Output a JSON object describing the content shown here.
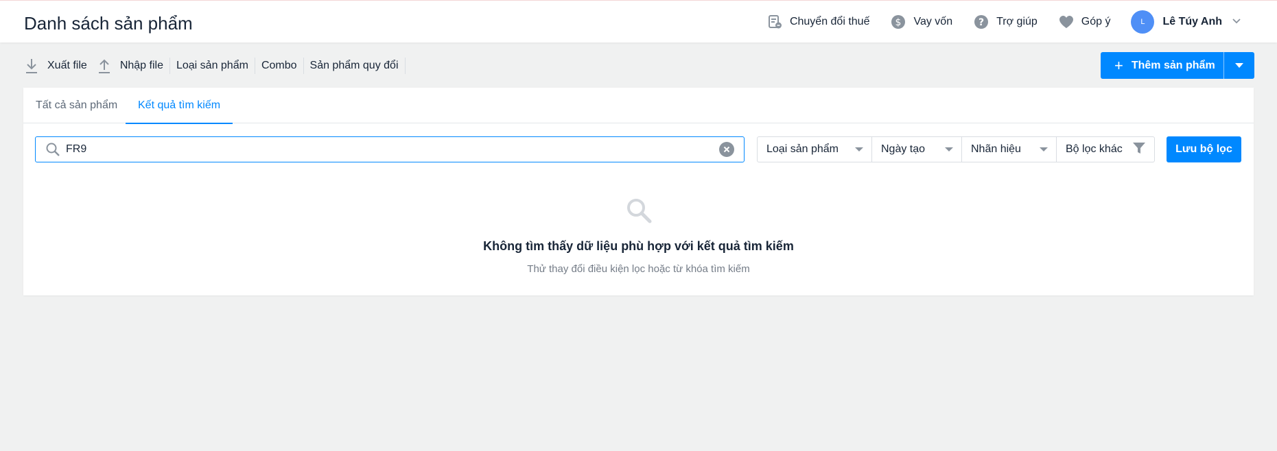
{
  "header": {
    "title": "Danh sách sản phẩm",
    "actions": [
      {
        "label": "Chuyển đổi thuế",
        "icon": "tax-convert-icon"
      },
      {
        "label": "Vay vốn",
        "icon": "dollar-icon"
      },
      {
        "label": "Trợ giúp",
        "icon": "help-icon"
      },
      {
        "label": "Góp ý",
        "icon": "heart-icon"
      }
    ],
    "user": {
      "avatar_initial": "L",
      "name": "Lê Túy Anh"
    }
  },
  "toolbar": {
    "export_label": "Xuất file",
    "import_label": "Nhập file",
    "category_label": "Loại sản phẩm",
    "combo_label": "Combo",
    "conversion_label": "Sản phẩm quy đổi",
    "add_label": "Thêm sản phẩm"
  },
  "tabs": [
    {
      "label": "Tất cả sản phẩm",
      "active": false
    },
    {
      "label": "Kết quả tìm kiếm",
      "active": true
    }
  ],
  "search": {
    "value": "FR9"
  },
  "filters": [
    {
      "label": "Loại sản phẩm"
    },
    {
      "label": "Ngày tạo"
    },
    {
      "label": "Nhãn hiệu"
    },
    {
      "label": "Bộ lọc khác"
    }
  ],
  "save_filter_label": "Lưu bộ lọc",
  "empty_state": {
    "icon": "search-icon",
    "title": "Không tìm thấy dữ liệu phù hợp với kết quả tìm kiếm",
    "subtitle": "Thử thay đổi điều kiện lọc hoặc từ khóa tìm kiếm"
  },
  "colors": {
    "primary": "#0088ff",
    "text": "#182537",
    "muted": "#747c87",
    "background": "#f0f1f1"
  }
}
